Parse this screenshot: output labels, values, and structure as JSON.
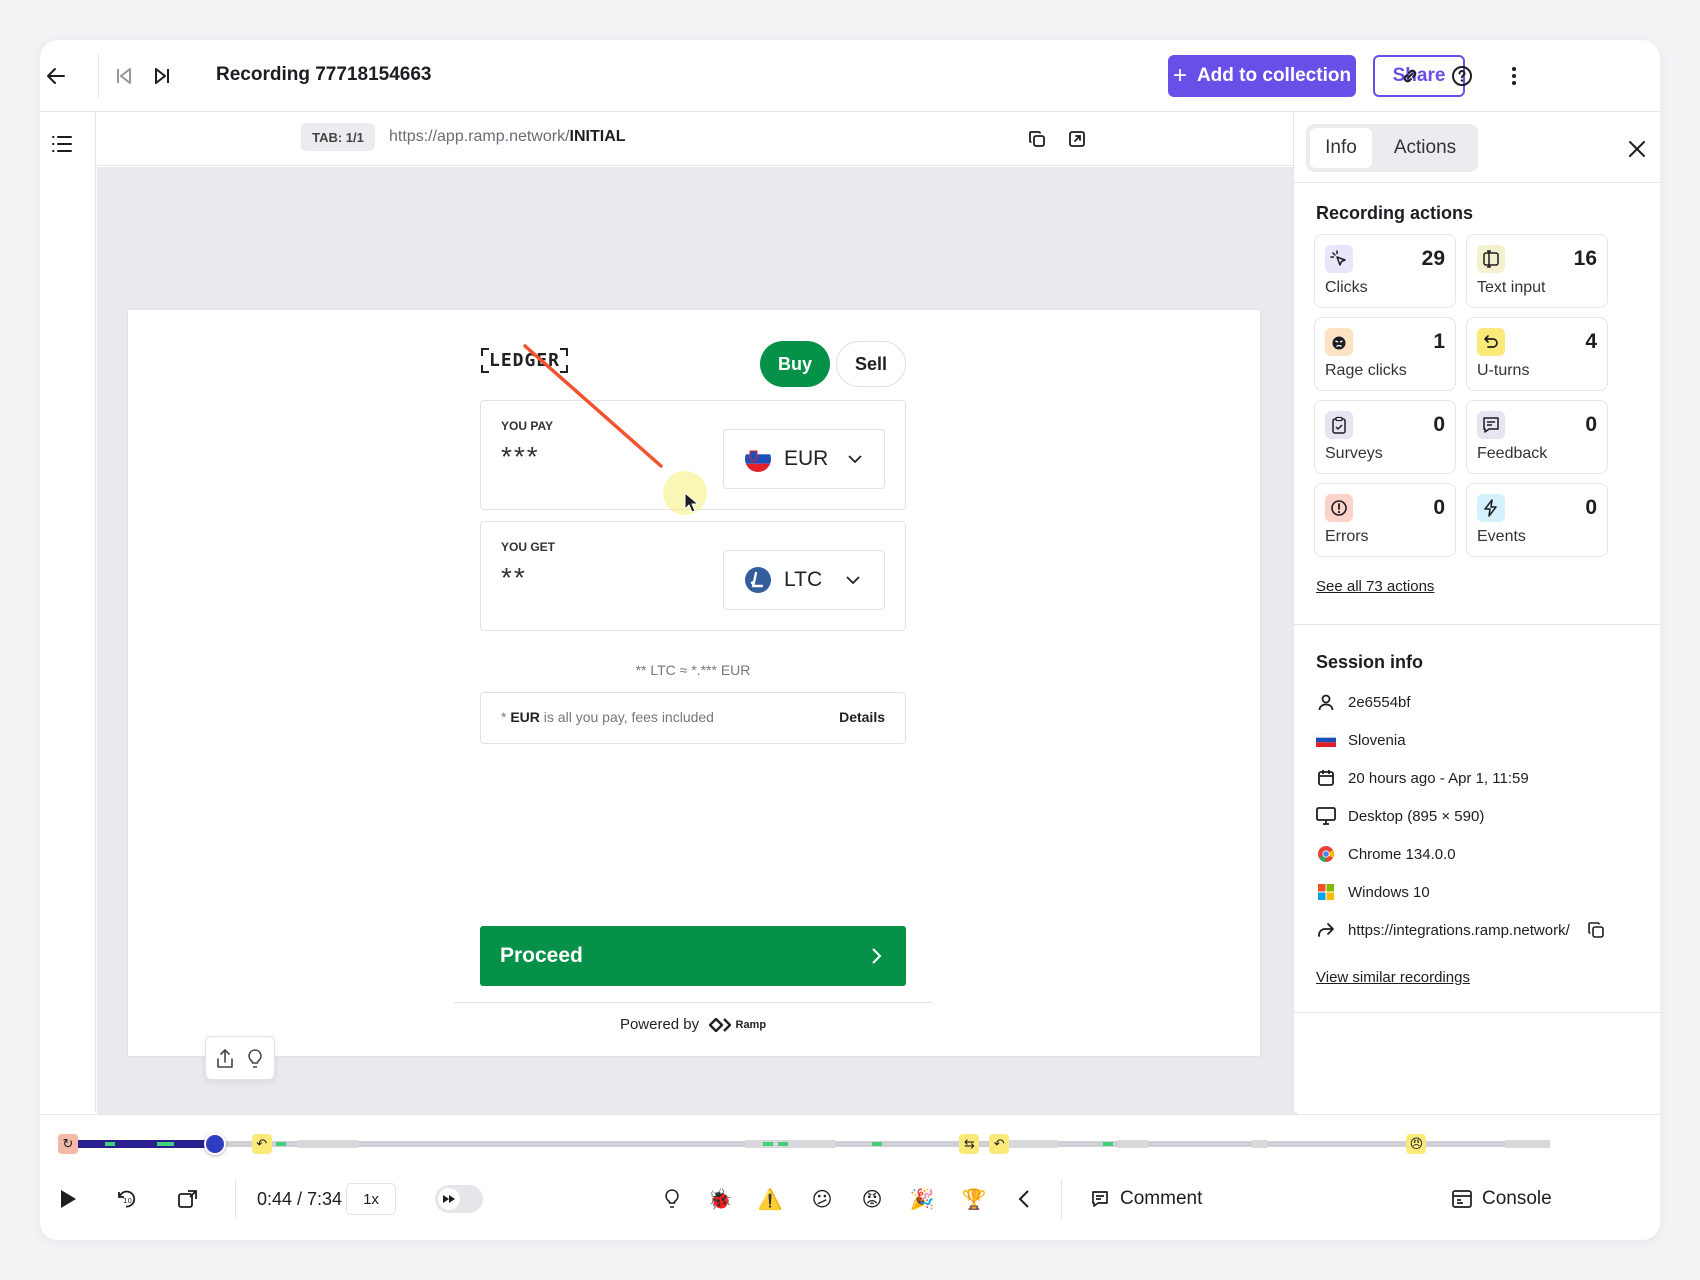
{
  "header": {
    "title": "Recording 77718154663",
    "add_to_collection": "Add to collection",
    "share": "Share"
  },
  "urlbar": {
    "tab": "TAB: 1/1",
    "url_prefix": "https://app.ramp.network/",
    "url_suffix": "INITIAL"
  },
  "widget": {
    "logo": "LEDGER",
    "buy": "Buy",
    "sell": "Sell",
    "you_pay_label": "YOU PAY",
    "you_pay_value": "***",
    "pay_currency": "EUR",
    "you_get_label": "YOU GET",
    "you_get_value": "**",
    "get_currency": "LTC",
    "rate": "** LTC ≈ *.*** EUR",
    "fee_prefix": "* ",
    "fee_currency": "EUR",
    "fee_text": " is all you pay, fees included",
    "details": "Details",
    "proceed": "Proceed",
    "powered_by": "Powered by",
    "ramp_logo": "Ramp"
  },
  "panel": {
    "tabs": [
      "Info",
      "Actions"
    ],
    "recording_actions_title": "Recording actions",
    "actions": [
      {
        "label": "Clicks",
        "count": "29",
        "icon": "click-icon",
        "color": "#e8e6fb"
      },
      {
        "label": "Text input",
        "count": "16",
        "icon": "text-input-icon",
        "color": "#f4f1cf"
      },
      {
        "label": "Rage clicks",
        "count": "1",
        "icon": "rage-icon",
        "color": "#fde3c3"
      },
      {
        "label": "U-turns",
        "count": "4",
        "icon": "u-turn-icon",
        "color": "#fbe97a"
      },
      {
        "label": "Surveys",
        "count": "0",
        "icon": "survey-icon",
        "color": "#e6e6f3"
      },
      {
        "label": "Feedback",
        "count": "0",
        "icon": "feedback-icon",
        "color": "#e6e6f3"
      },
      {
        "label": "Errors",
        "count": "0",
        "icon": "error-icon",
        "color": "#fbd3cb"
      },
      {
        "label": "Events",
        "count": "0",
        "icon": "events-icon",
        "color": "#d5f1fb"
      }
    ],
    "see_all": "See all 73 actions",
    "session_info_title": "Session info",
    "session": {
      "user": "2e6554bf",
      "country": "Slovenia",
      "date": "20 hours ago - Apr 1, 11:59",
      "device": "Desktop (895 × 590)",
      "browser": "Chrome 134.0.0",
      "os": "Windows 10",
      "referrer": "https://integrations.ramp.network/"
    },
    "view_similar": "View similar recordings"
  },
  "player": {
    "time": "0:44 / 7:34",
    "speed": "1x",
    "comment": "Comment",
    "console": "Console",
    "progress": 0.104
  },
  "colors": {
    "accent": "#6a4ee8",
    "green": "#069149",
    "timeline_played": "#2b1f8f"
  }
}
